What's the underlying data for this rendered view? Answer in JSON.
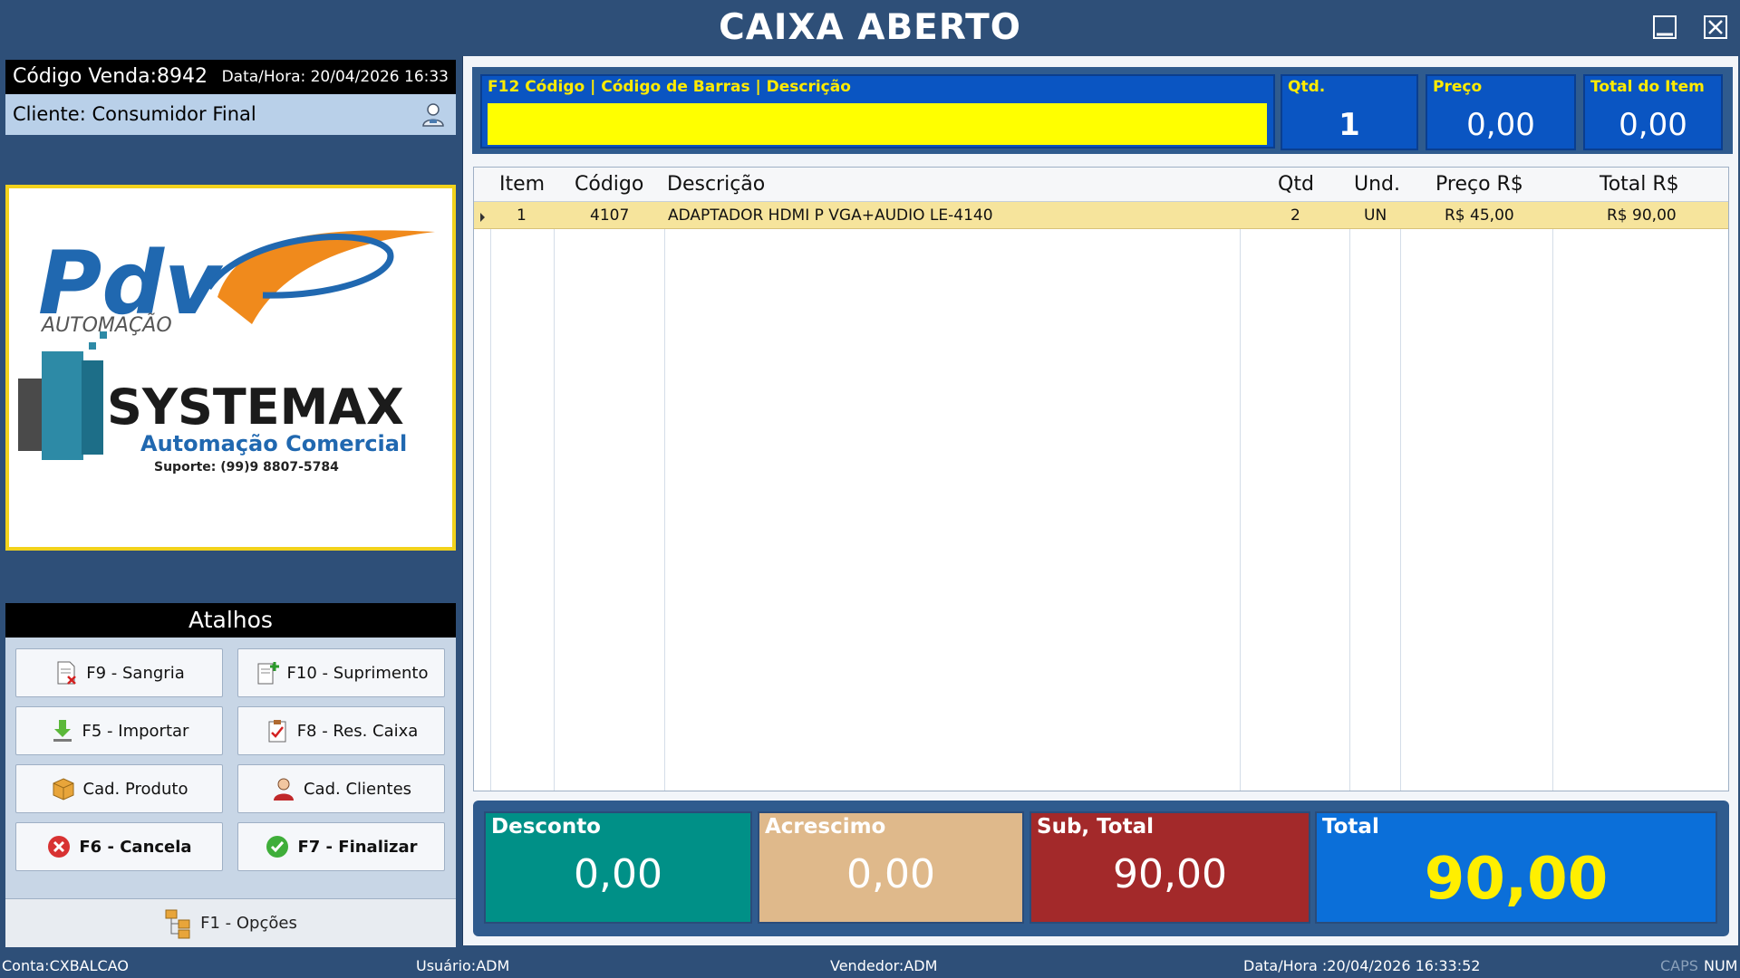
{
  "window": {
    "title": "CAIXA ABERTO"
  },
  "sale": {
    "code_label": "Código Venda:8942",
    "datetime_label": "Data/Hora: 20/04/2026 16:33"
  },
  "client": {
    "label": "Cliente: Consumidor Final"
  },
  "logo": {
    "brand_top": "Pdv",
    "brand_sub": "AUTOMAÇÃO",
    "company": "SYSTEMAX",
    "company_sub": "Automação Comercial",
    "support": "Suporte: (99)9 8807-5784"
  },
  "shortcuts": {
    "title": "Atalhos",
    "buttons": [
      {
        "label": "F9 - Sangria",
        "icon": "document-remove-icon"
      },
      {
        "label": "F10 - Suprimento",
        "icon": "document-add-icon"
      },
      {
        "label": "F5 - Importar",
        "icon": "download-icon"
      },
      {
        "label": "F8 - Res. Caixa",
        "icon": "clipboard-check-icon"
      },
      {
        "label": "Cad. Produto",
        "icon": "box-icon"
      },
      {
        "label": "Cad. Clientes",
        "icon": "user-icon"
      },
      {
        "label": "F6 - Cancela",
        "icon": "cancel-icon"
      },
      {
        "label": "F7 - Finalizar",
        "icon": "check-icon"
      }
    ],
    "options_label": "F1 - Opções"
  },
  "entry": {
    "search_label": "F12  Código | Código de Barras | Descrição",
    "search_value": "",
    "qtd_label": "Qtd.",
    "qtd_value": "1",
    "preco_label": "Preço",
    "preco_value": "0,00",
    "total_item_label": "Total do Item",
    "total_item_value": "0,00"
  },
  "table": {
    "columns": [
      "Item",
      "Código",
      "Descrição",
      "Qtd",
      "Und.",
      "Preço R$",
      "Total R$"
    ],
    "rows": [
      {
        "item": "1",
        "codigo": "4107",
        "descricao": "ADAPTADOR HDMI P VGA+AUDIO LE-4140",
        "qtd": "2",
        "und": "UN",
        "preco": "R$ 45,00",
        "total": "R$ 90,00"
      }
    ]
  },
  "totals": {
    "desconto_label": "Desconto",
    "desconto_value": "0,00",
    "acrescimo_label": "Acrescimo",
    "acrescimo_value": "0,00",
    "subtotal_label": "Sub, Total",
    "subtotal_value": "90,00",
    "total_label": "Total",
    "total_value": "90,00"
  },
  "status": {
    "conta": "Conta:CXBALCAO",
    "usuario": "Usuário:ADM",
    "vendedor": "Vendedor:ADM",
    "datahora": "Data/Hora :20/04/2026 16:33:52",
    "caps": "CAPS",
    "num": "NUM"
  },
  "colors": {
    "background": "#2e4f78",
    "accent_yellow": "#ffff00",
    "total_blue": "#0b6fd9",
    "subtotal_red": "#a3292a",
    "discount_teal": "#009087",
    "surcharge_tan": "#dfb98b"
  }
}
